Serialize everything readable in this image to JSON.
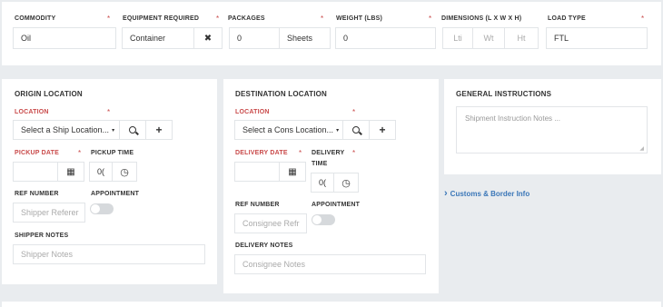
{
  "top": {
    "commodity": {
      "label": "COMMODITY",
      "required": "*",
      "value": "Oil"
    },
    "equipment": {
      "label": "EQUIPMENT REQUIRED",
      "required": "*",
      "value": "Container",
      "clear_icon": "close-icon",
      "clear_glyph": "✖"
    },
    "packages": {
      "label": "PACKAGES",
      "required": "*",
      "value": "0",
      "unit": "Sheets"
    },
    "weight": {
      "label": "WEIGHT (LBS)",
      "required": "*",
      "value": "0"
    },
    "dimensions": {
      "label": "DIMENSIONS (L X W X H)",
      "l_placeholder": "Lti",
      "w_placeholder": "Wt",
      "h_placeholder": "Ht"
    },
    "load_type": {
      "label": "LOAD TYPE",
      "required": "*",
      "value": "FTL"
    }
  },
  "origin": {
    "title": "ORIGIN LOCATION",
    "location_label": "LOCATION",
    "required": "*",
    "location_select": "Select a Ship Location...",
    "caret": "▾",
    "search_glyph": "🔍",
    "add_glyph": "+",
    "pickup_date_label": "PICKUP DATE",
    "pickup_time_label": "PICKUP TIME",
    "time_value": "0(",
    "calendar_glyph": "▦",
    "clock_glyph": "◷",
    "ref_label": "REF NUMBER",
    "ref_placeholder": "Shipper Referer",
    "appointment_label": "APPOINTMENT",
    "notes_label": "SHIPPER NOTES",
    "notes_placeholder": "Shipper Notes"
  },
  "destination": {
    "title": "DESTINATION LOCATION",
    "location_label": "LOCATION",
    "required": "*",
    "location_select": "Select a Cons Location...",
    "caret": "▾",
    "search_glyph": "🔍",
    "add_glyph": "+",
    "delivery_date_label": "DELIVERY DATE",
    "delivery_label_line1": "DELIVERY",
    "delivery_label_line2": "TIME",
    "time_value": "0(",
    "calendar_glyph": "▦",
    "clock_glyph": "◷",
    "ref_label": "REF NUMBER",
    "ref_placeholder": "Consignee Refr",
    "appointment_label": "APPOINTMENT",
    "notes_label": "DELIVERY NOTES",
    "notes_placeholder": "Consignee Notes"
  },
  "general": {
    "title": "GENERAL INSTRUCTIONS",
    "placeholder": "Shipment Instruction Notes ...",
    "resize_glyph": "◢"
  },
  "customs_link": {
    "chevron": "›",
    "label": "Customs & Border Info"
  }
}
